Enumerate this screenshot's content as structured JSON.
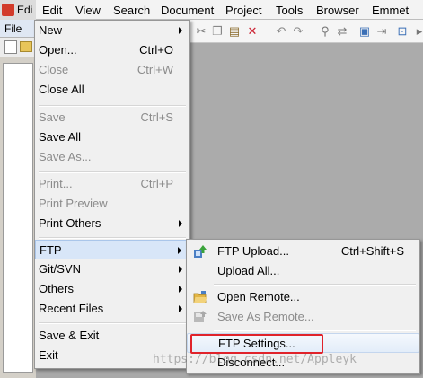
{
  "app": {
    "title": "Edi"
  },
  "menubar": [
    "Edit",
    "View",
    "Search",
    "Document",
    "Project",
    "Tools",
    "Browser",
    "Emmet"
  ],
  "file_tab": "File",
  "file_menu": {
    "items": [
      {
        "label": "New",
        "shortcut": "",
        "submenu": true,
        "disabled": false
      },
      {
        "label": "Open...",
        "shortcut": "Ctrl+O",
        "submenu": false,
        "disabled": false
      },
      {
        "label": "Close",
        "shortcut": "Ctrl+W",
        "submenu": false,
        "disabled": true
      },
      {
        "label": "Close All",
        "shortcut": "",
        "submenu": false,
        "disabled": false
      },
      {
        "label": "Save",
        "shortcut": "Ctrl+S",
        "submenu": false,
        "disabled": true
      },
      {
        "label": "Save All",
        "shortcut": "",
        "submenu": false,
        "disabled": false
      },
      {
        "label": "Save As...",
        "shortcut": "",
        "submenu": false,
        "disabled": true
      },
      {
        "label": "Print...",
        "shortcut": "Ctrl+P",
        "submenu": false,
        "disabled": true
      },
      {
        "label": "Print Preview",
        "shortcut": "",
        "submenu": false,
        "disabled": true
      },
      {
        "label": "Print Others",
        "shortcut": "",
        "submenu": true,
        "disabled": false
      },
      {
        "label": "FTP",
        "shortcut": "",
        "submenu": true,
        "disabled": false,
        "highlighted": true
      },
      {
        "label": "Git/SVN",
        "shortcut": "",
        "submenu": true,
        "disabled": false
      },
      {
        "label": "Others",
        "shortcut": "",
        "submenu": true,
        "disabled": false
      },
      {
        "label": "Recent Files",
        "shortcut": "",
        "submenu": true,
        "disabled": false
      },
      {
        "label": "Save & Exit",
        "shortcut": "",
        "submenu": false,
        "disabled": false
      },
      {
        "label": "Exit",
        "shortcut": "",
        "submenu": false,
        "disabled": false
      }
    ]
  },
  "ftp_submenu": {
    "items": [
      {
        "label": "FTP Upload...",
        "shortcut": "Ctrl+Shift+S",
        "icon": "ftp-upload-icon",
        "disabled": false
      },
      {
        "label": "Upload All...",
        "shortcut": "",
        "icon": "",
        "disabled": false
      },
      {
        "label": "Open Remote...",
        "shortcut": "",
        "icon": "open-folder-icon",
        "disabled": false
      },
      {
        "label": "Save As Remote...",
        "shortcut": "",
        "icon": "save-remote-icon",
        "disabled": true
      },
      {
        "label": "FTP Settings...",
        "shortcut": "",
        "icon": "",
        "disabled": false,
        "selected": true
      },
      {
        "label": "Disconnect...",
        "shortcut": "",
        "icon": "",
        "disabled": false
      }
    ]
  },
  "watermark": "https://blog.csdn.net/Appleyk",
  "colors": {
    "highlight_box": "#e0232b",
    "menu_bg": "#f0f0f0",
    "disabled_text": "#8b8b8b"
  }
}
